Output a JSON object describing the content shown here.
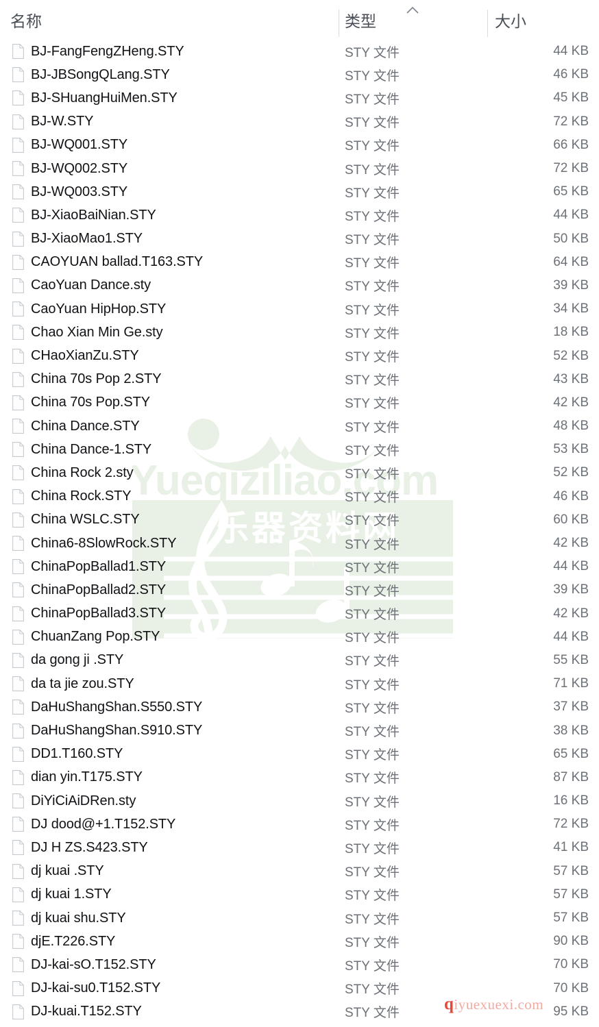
{
  "columns": {
    "name": "名称",
    "type": "类型",
    "size": "大小",
    "sort_indicator": "ascending-chevron"
  },
  "watermarks": {
    "main": {
      "text": "Yueqiziliao.com",
      "subtext": "乐器资料网",
      "color": "#e7efe4"
    },
    "bottom": {
      "prefix": "q",
      "rest": "iyuexuexi.com",
      "color": "#f4a9a0",
      "accent": "#e8483a"
    }
  },
  "files": [
    {
      "name": "BJ-FangFengZHeng.STY",
      "type": "STY 文件",
      "size": "44 KB"
    },
    {
      "name": "BJ-JBSongQLang.STY",
      "type": "STY 文件",
      "size": "46 KB"
    },
    {
      "name": "BJ-SHuangHuiMen.STY",
      "type": "STY 文件",
      "size": "45 KB"
    },
    {
      "name": "BJ-W.STY",
      "type": "STY 文件",
      "size": "72 KB"
    },
    {
      "name": "BJ-WQ001.STY",
      "type": "STY 文件",
      "size": "66 KB"
    },
    {
      "name": "BJ-WQ002.STY",
      "type": "STY 文件",
      "size": "72 KB"
    },
    {
      "name": "BJ-WQ003.STY",
      "type": "STY 文件",
      "size": "65 KB"
    },
    {
      "name": "BJ-XiaoBaiNian.STY",
      "type": "STY 文件",
      "size": "44 KB"
    },
    {
      "name": "BJ-XiaoMao1.STY",
      "type": "STY 文件",
      "size": "50 KB"
    },
    {
      "name": "CAOYUAN ballad.T163.STY",
      "type": "STY 文件",
      "size": "64 KB"
    },
    {
      "name": "CaoYuan Dance.sty",
      "type": "STY 文件",
      "size": "39 KB"
    },
    {
      "name": "CaoYuan HipHop.STY",
      "type": "STY 文件",
      "size": "34 KB"
    },
    {
      "name": "Chao Xian Min Ge.sty",
      "type": "STY 文件",
      "size": "18 KB"
    },
    {
      "name": "CHaoXianZu.STY",
      "type": "STY 文件",
      "size": "52 KB"
    },
    {
      "name": "China 70s Pop 2.STY",
      "type": "STY 文件",
      "size": "43 KB"
    },
    {
      "name": "China 70s Pop.STY",
      "type": "STY 文件",
      "size": "42 KB"
    },
    {
      "name": "China Dance.STY",
      "type": "STY 文件",
      "size": "48 KB"
    },
    {
      "name": "China Dance-1.STY",
      "type": "STY 文件",
      "size": "53 KB"
    },
    {
      "name": "China Rock 2.sty",
      "type": "STY 文件",
      "size": "52 KB"
    },
    {
      "name": "China Rock.STY",
      "type": "STY 文件",
      "size": "46 KB"
    },
    {
      "name": "China WSLC.STY",
      "type": "STY 文件",
      "size": "60 KB"
    },
    {
      "name": "China6-8SlowRock.STY",
      "type": "STY 文件",
      "size": "42 KB"
    },
    {
      "name": "ChinaPopBallad1.STY",
      "type": "STY 文件",
      "size": "44 KB"
    },
    {
      "name": "ChinaPopBallad2.STY",
      "type": "STY 文件",
      "size": "39 KB"
    },
    {
      "name": "ChinaPopBallad3.STY",
      "type": "STY 文件",
      "size": "42 KB"
    },
    {
      "name": "ChuanZang Pop.STY",
      "type": "STY 文件",
      "size": "44 KB"
    },
    {
      "name": "da gong ji .STY",
      "type": "STY 文件",
      "size": "55 KB"
    },
    {
      "name": "da ta jie zou.STY",
      "type": "STY 文件",
      "size": "71 KB"
    },
    {
      "name": "DaHuShangShan.S550.STY",
      "type": "STY 文件",
      "size": "37 KB"
    },
    {
      "name": "DaHuShangShan.S910.STY",
      "type": "STY 文件",
      "size": "38 KB"
    },
    {
      "name": "DD1.T160.STY",
      "type": "STY 文件",
      "size": "65 KB"
    },
    {
      "name": "dian yin.T175.STY",
      "type": "STY 文件",
      "size": "87 KB"
    },
    {
      "name": "DiYiCiAiDRen.sty",
      "type": "STY 文件",
      "size": "16 KB"
    },
    {
      "name": "DJ dood@+1.T152.STY",
      "type": "STY 文件",
      "size": "72 KB"
    },
    {
      "name": "DJ H  ZS.S423.STY",
      "type": "STY 文件",
      "size": "41 KB"
    },
    {
      "name": "dj kuai .STY",
      "type": "STY 文件",
      "size": "57 KB"
    },
    {
      "name": "dj kuai 1.STY",
      "type": "STY 文件",
      "size": "57 KB"
    },
    {
      "name": "dj kuai shu.STY",
      "type": "STY 文件",
      "size": "57 KB"
    },
    {
      "name": "djE.T226.STY",
      "type": "STY 文件",
      "size": "90 KB"
    },
    {
      "name": "DJ-kai-sO.T152.STY",
      "type": "STY 文件",
      "size": "70 KB"
    },
    {
      "name": "DJ-kai-su0.T152.STY",
      "type": "STY 文件",
      "size": "70 KB"
    },
    {
      "name": "DJ-kuai.T152.STY",
      "type": "STY 文件",
      "size": "95 KB"
    }
  ]
}
